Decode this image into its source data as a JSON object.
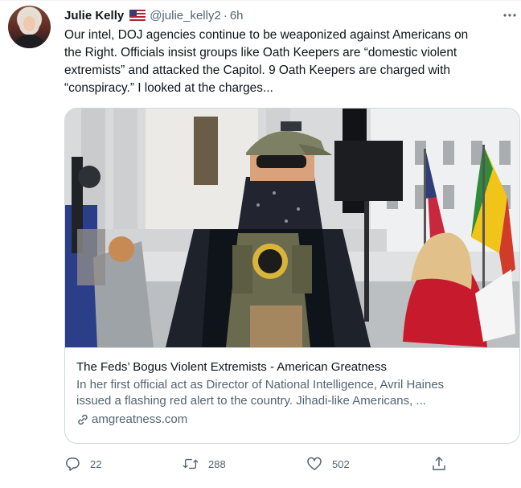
{
  "tweet": {
    "author_name": "Julie Kelly",
    "author_flag_icon": "us-flag-icon",
    "handle": "@julie_kelly2",
    "separator": "·",
    "time": "6h",
    "more_icon": "more-horizontal-icon",
    "text_lines": [
      "Our intel, DOJ agencies continue to be weaponized against Americans on",
      "the Right. Officials insist groups like Oath Keepers are “domestic violent",
      "extremists” and attacked the Capitol. 9 Oath Keepers are charged with",
      "“conspiracy.” I looked at the charges..."
    ]
  },
  "card": {
    "title": "The Feds’ Bogus Violent Extremists - American Greatness",
    "description_lines": [
      "In her first official act as Director of National Intelligence, Avril Haines",
      "issued a flashing red alert to the country. Jihadi-like Americans, ..."
    ],
    "link_icon": "link-icon",
    "domain": "amgreatness.com"
  },
  "actions": {
    "reply": {
      "icon": "reply-icon",
      "count": "22"
    },
    "retweet": {
      "icon": "retweet-icon",
      "count": "288"
    },
    "like": {
      "icon": "heart-icon",
      "count": "502"
    },
    "share": {
      "icon": "share-icon"
    }
  },
  "colors": {
    "text_primary": "#0f1419",
    "text_secondary": "#536471",
    "border": "#cfd9de",
    "background": "#ffffff"
  }
}
